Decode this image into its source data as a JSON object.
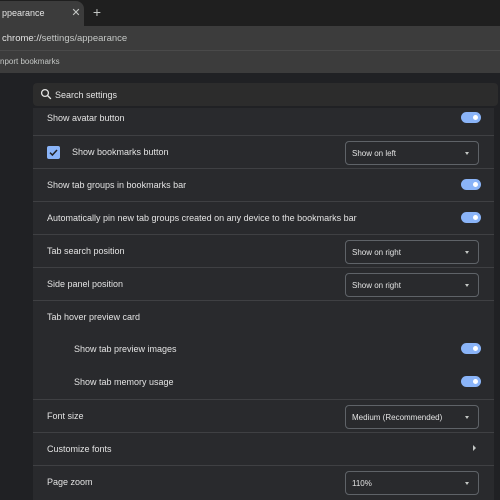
{
  "browser": {
    "tab_title": "ppearance",
    "tab_close": "✕",
    "new_tab": "+",
    "url_host": "chrome://",
    "url_path": "settings/appearance",
    "bookmark_label": "nport bookmarks"
  },
  "search": {
    "placeholder": "Search settings"
  },
  "settings": {
    "show_avatar": {
      "label": "Show avatar button",
      "enabled": true
    },
    "show_bookmarks": {
      "label": "Show bookmarks button",
      "checked": true,
      "option": "Show on left"
    },
    "tab_groups_bar": {
      "label": "Show tab groups in bookmarks bar",
      "enabled": true
    },
    "auto_pin": {
      "label": "Automatically pin new tab groups created on any device to the bookmarks bar",
      "enabled": true
    },
    "tab_search_position": {
      "label": "Tab search position",
      "option": "Show on right"
    },
    "side_panel_position": {
      "label": "Side panel position",
      "option": "Show on right"
    },
    "hover_card": {
      "label": "Tab hover preview card"
    },
    "preview_images": {
      "label": "Show tab preview images",
      "enabled": true
    },
    "memory_usage": {
      "label": "Show tab memory usage",
      "enabled": true
    },
    "font_size": {
      "label": "Font size",
      "option": "Medium (Recommended)"
    },
    "customize_fonts": {
      "label": "Customize fonts"
    },
    "page_zoom": {
      "label": "Page zoom",
      "option": "110%"
    }
  },
  "colors": {
    "accent": "#8ab4f8",
    "background": "#202124",
    "card": "#292a2d"
  }
}
